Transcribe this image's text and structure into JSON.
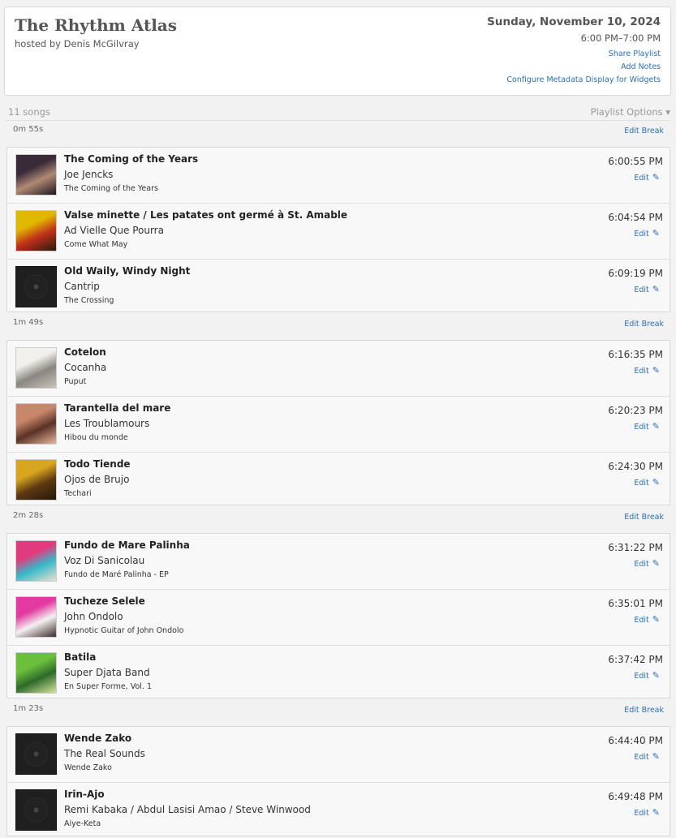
{
  "header": {
    "title": "The Rhythm Atlas",
    "host": "hosted by Denis McGilvray",
    "date": "Sunday, November 10, 2024",
    "time": "6:00 PM–7:00 PM",
    "links": [
      "Share Playlist",
      "Add Notes",
      "Configure Metadata Display for Widgets"
    ]
  },
  "playlist": {
    "count": "11 songs",
    "options_label": "Playlist Options ▾",
    "edit_break_label": "Edit Break",
    "edit_label": "Edit",
    "breaks": [
      "0m 55s",
      "1m 49s",
      "2m 28s",
      "1m 23s"
    ],
    "groups": [
      [
        {
          "title": "The Coming of the Years",
          "artist": "Joe Jencks",
          "album": "The Coming of the Years",
          "time": "6:00:55 PM",
          "art": "cover",
          "art_colors": [
            "#3a2b38",
            "#b08a74",
            "#1d1620"
          ]
        },
        {
          "title": "Valse minette / Les patates ont germé à St. Amable",
          "artist": "Ad Vielle Que Pourra",
          "album": "Come What May",
          "time": "6:04:54 PM",
          "art": "cover",
          "art_colors": [
            "#e0b800",
            "#c0301b",
            "#2a1a0c"
          ]
        },
        {
          "title": "Old Waily, Windy Night",
          "artist": "Cantrip",
          "album": "The Crossing",
          "time": "6:09:19 PM",
          "art": "vinyl"
        }
      ],
      [
        {
          "title": "Cotelon",
          "artist": "Cocanha",
          "album": "Puput",
          "time": "6:16:35 PM",
          "art": "cover",
          "art_colors": [
            "#f2f0ea",
            "#8a8680",
            "#c9c4b8"
          ]
        },
        {
          "title": "Tarantella del mare",
          "artist": "Les Troublamours",
          "album": "Hibou du monde",
          "time": "6:20:23 PM",
          "art": "cover",
          "art_colors": [
            "#c8866a",
            "#5a3226",
            "#e6b79d"
          ]
        },
        {
          "title": "Todo Tiende",
          "artist": "Ojos de Brujo",
          "album": "Techari",
          "time": "6:24:30 PM",
          "art": "cover",
          "art_colors": [
            "#d8a51e",
            "#5e3a12",
            "#241608"
          ]
        }
      ],
      [
        {
          "title": "Fundo de Mare Palinha",
          "artist": "Voz Di Sanicolau",
          "album": "Fundo de Maré Palinha - EP",
          "time": "6:31:22 PM",
          "art": "cover",
          "art_colors": [
            "#e23a7e",
            "#37b8c8",
            "#e8e0d0"
          ]
        },
        {
          "title": "Tucheze Selele",
          "artist": "John Ondolo",
          "album": "Hypnotic Guitar of John Ondolo",
          "time": "6:35:01 PM",
          "art": "cover",
          "art_colors": [
            "#e23aa0",
            "#f5f0f0",
            "#3a2a2a"
          ]
        },
        {
          "title": "Batila",
          "artist": "Super Djata Band",
          "album": "En Super Forme, Vol. 1",
          "time": "6:37:42 PM",
          "art": "cover",
          "art_colors": [
            "#6cbf3a",
            "#2d6a2a",
            "#d6e3a0"
          ]
        }
      ],
      [
        {
          "title": "Wende Zako",
          "artist": "The Real Sounds",
          "album": "Wende Zako",
          "time": "6:44:40 PM",
          "art": "vinyl"
        },
        {
          "title": "Irin-Ajo",
          "artist": "Remi Kabaka / Abdul Lasisi Amao / Steve Winwood",
          "album": "Aiye-Keta",
          "time": "6:49:48 PM",
          "art": "vinyl"
        }
      ]
    ]
  },
  "colors": {
    "link": "#2a6fb5",
    "background": "#f3f2f2",
    "card": "#f9f8f8"
  }
}
